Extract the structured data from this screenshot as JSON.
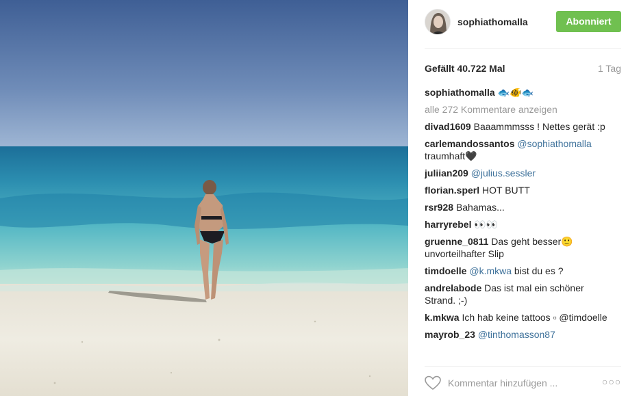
{
  "post": {
    "username": "sophiathomalla",
    "follow_label": "Abonniert",
    "likes": "Gefällt 40.722 Mal",
    "age": "1 Tag",
    "caption_user": "sophiathomalla",
    "caption_text": "🐟🐠🐟",
    "view_all": "alle 272 Kommentare anzeigen",
    "comment_placeholder": "Kommentar hinzufügen ...",
    "options_label": "○○○"
  },
  "comments": [
    {
      "user": "divad1609",
      "mention": "",
      "text": "Baaammmsss ! Nettes gerät :p"
    },
    {
      "user": "carlemandossantos",
      "mention": "@sophiathomalla",
      "text": "traumhaft🖤"
    },
    {
      "user": "juliian209",
      "mention": "@julius.sessler",
      "text": ""
    },
    {
      "user": "florian.sperl",
      "mention": "",
      "text": "HOT BUTT"
    },
    {
      "user": "rsr928",
      "mention": "",
      "text": "Bahamas..."
    },
    {
      "user": "harryrebel",
      "mention": "",
      "text": "👀👀"
    },
    {
      "user": "gruenne_0811",
      "mention": "",
      "text": "Das geht besser🙂 unvorteilhafter Slip"
    },
    {
      "user": "timdoelle",
      "mention": "@k.mkwa",
      "text": "bist du es ?"
    },
    {
      "user": "andrelabode",
      "mention": "",
      "text": "Das ist mal ein schöner Strand. ;-)"
    },
    {
      "user": "k.mkwa",
      "mention": "",
      "text": "Ich hab keine tattoos ▫ @timdoelle"
    },
    {
      "user": "mayrob_23",
      "mention": "@tinthomasson87",
      "text": ""
    }
  ],
  "icons": {
    "heart": "heart-icon",
    "options": "more-options-icon"
  },
  "colors": {
    "follow_button": "#70c050",
    "mention": "#3f729b",
    "muted": "#999999"
  }
}
